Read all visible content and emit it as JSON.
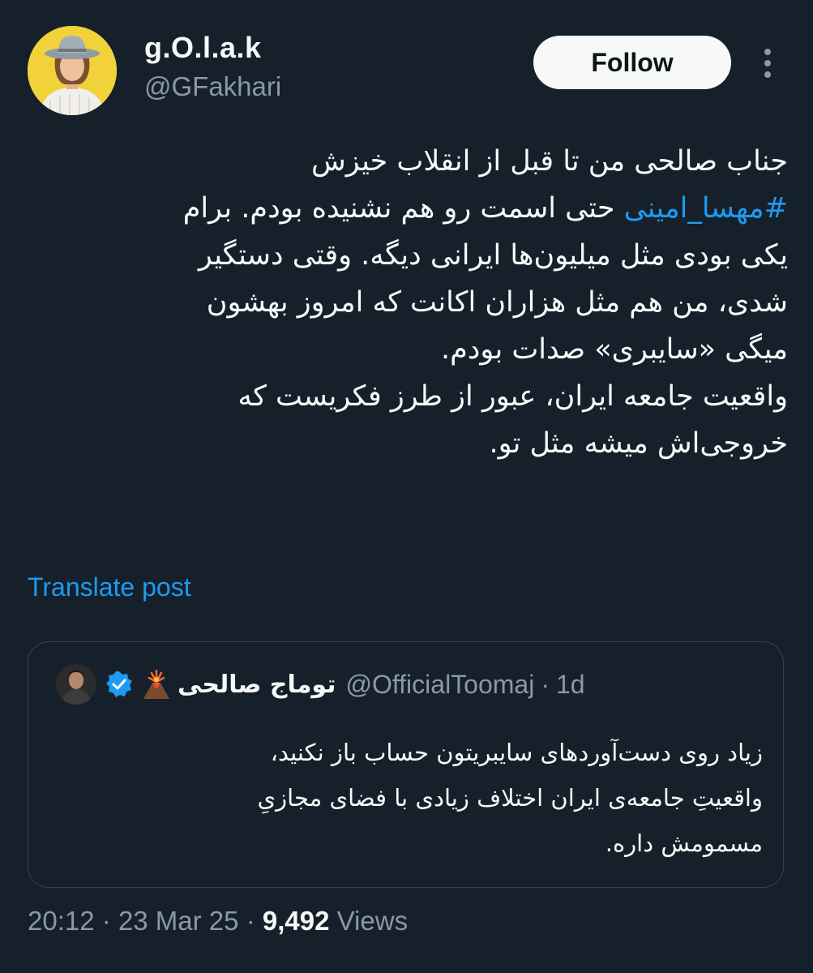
{
  "author": {
    "display_name": "g.O.l.a.k",
    "handle": "@GFakhari"
  },
  "follow_label": "Follow",
  "tweet": {
    "lines": [
      {
        "text": "جناب صالحی من تا قبل از انقلاب خیزش"
      },
      {
        "hashtag": "#مهسا_امینی",
        "text": " حتی اسمت رو هم نشنیده بودم. برام"
      },
      {
        "text": "یکی بودی مثل میلیون‌ها ایرانی دیگه. وقتی دستگیر"
      },
      {
        "text": "شدی، من هم مثل هزاران اکانت که امروز بهشون"
      },
      {
        "text": "میگی «سایبری» صدات بودم."
      },
      {
        "text": "واقعیت جامعه ایران، عبور از طرز فکریست که"
      },
      {
        "text": "خروجی‌اش میشه مثل تو."
      }
    ]
  },
  "translate_label": "Translate post",
  "quote": {
    "name": "توماج صالحی",
    "handle": "@OfficialToomaj",
    "separator": "·",
    "time": "1d",
    "lines": [
      "زیاد روی دست‌آوردهای سایبریتون حساب باز نکنید،",
      "واقعیتِ جامعه‌ی ایران اختلاف زیادی با فضای مجازیِ",
      "مسمومش داره."
    ]
  },
  "meta": {
    "time": "20:12",
    "separator": "·",
    "date": "23 Mar 25",
    "views_count": "9,492",
    "views_label": "Views"
  },
  "colors": {
    "background": "#15202b",
    "accent": "#1d9bf0",
    "secondary_text": "#8b98a5",
    "border": "#38444d"
  },
  "icons": {
    "more": "more-dots-icon",
    "verified": "verified-badge-icon",
    "volcano": "volcano-icon"
  }
}
